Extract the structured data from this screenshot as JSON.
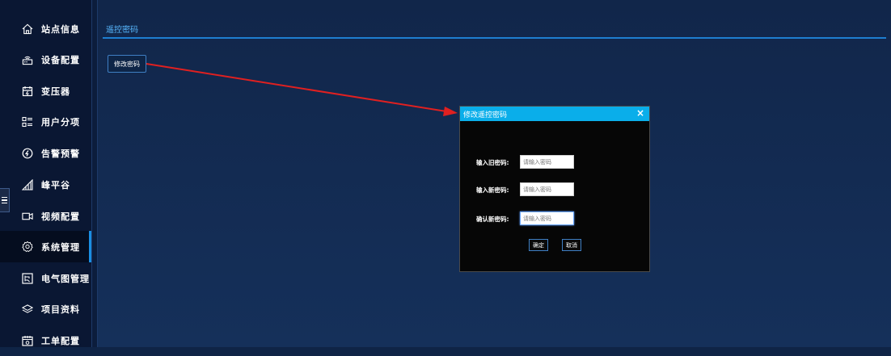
{
  "sidebar": {
    "items": [
      {
        "label": "站点信息",
        "icon": "home-icon"
      },
      {
        "label": "设备配置",
        "icon": "router-icon"
      },
      {
        "label": "变压器",
        "icon": "transformer-icon"
      },
      {
        "label": "用户分项",
        "icon": "category-list-icon"
      },
      {
        "label": "告警预警",
        "icon": "alarm-icon"
      },
      {
        "label": "峰平谷",
        "icon": "signal-bars-icon"
      },
      {
        "label": "视频配置",
        "icon": "video-camera-icon"
      },
      {
        "label": "系统管理",
        "icon": "settings-icon",
        "active": true
      },
      {
        "label": "电气图管理",
        "icon": "diagram-icon"
      },
      {
        "label": "项目资料",
        "icon": "layers-icon"
      },
      {
        "label": "工单配置",
        "icon": "work-order-icon"
      }
    ]
  },
  "main": {
    "header_title": "遥控密码",
    "change_button_label": "修改密码"
  },
  "modal": {
    "title": "修改遥控密码",
    "close_symbol": "×",
    "fields": [
      {
        "label": "输入旧密码:",
        "placeholder": "请输入密码"
      },
      {
        "label": "输入新密码:",
        "placeholder": "请输入密码"
      },
      {
        "label": "确认新密码:",
        "placeholder": "请输入密码"
      }
    ],
    "confirm_label": "确定",
    "cancel_label": "取消"
  },
  "colors": {
    "accent": "#0aaeea",
    "annotation_arrow": "#e02020",
    "sidebar_bg": "#0a1733",
    "main_bg": "#11264a"
  }
}
